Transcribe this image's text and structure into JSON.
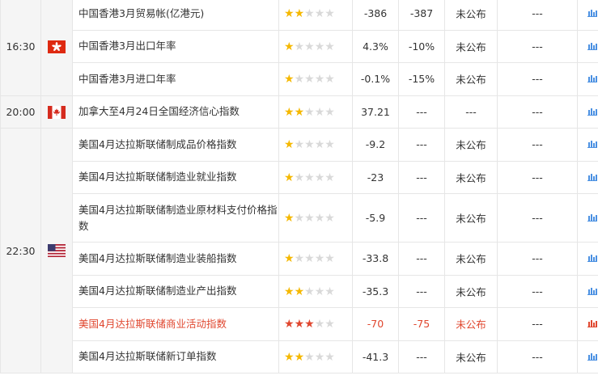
{
  "rows": [
    {
      "time": "16:30",
      "flag": "hong-kong",
      "name": "中国香港3月贸易帐(亿港元)",
      "stars": 2,
      "prev": "-386",
      "forecast": "-387",
      "actual": "未公布",
      "effect": "---",
      "highlight": false
    },
    {
      "time": "",
      "flag": "",
      "name": "中国香港3月出口年率",
      "stars": 1,
      "prev": "4.3%",
      "forecast": "-10%",
      "actual": "未公布",
      "effect": "---",
      "highlight": false
    },
    {
      "time": "",
      "flag": "",
      "name": "中国香港3月进口年率",
      "stars": 1,
      "prev": "-0.1%",
      "forecast": "-15%",
      "actual": "未公布",
      "effect": "---",
      "highlight": false
    },
    {
      "time": "20:00",
      "flag": "canada",
      "name": "加拿大至4月24日全国经济信心指数",
      "stars": 2,
      "prev": "37.21",
      "forecast": "---",
      "actual": "---",
      "effect": "---",
      "highlight": false
    },
    {
      "time": "22:30",
      "flag": "usa",
      "name": "美国4月达拉斯联储制成品价格指数",
      "stars": 1,
      "prev": "-9.2",
      "forecast": "---",
      "actual": "未公布",
      "effect": "---",
      "highlight": false
    },
    {
      "time": "",
      "flag": "",
      "name": "美国4月达拉斯联储制造业就业指数",
      "stars": 1,
      "prev": "-23",
      "forecast": "---",
      "actual": "未公布",
      "effect": "---",
      "highlight": false
    },
    {
      "time": "",
      "flag": "",
      "name": "美国4月达拉斯联储制造业原材料支付价格指数",
      "stars": 1,
      "prev": "-5.9",
      "forecast": "---",
      "actual": "未公布",
      "effect": "---",
      "highlight": false
    },
    {
      "time": "",
      "flag": "",
      "name": "美国4月达拉斯联储制造业装船指数",
      "stars": 1,
      "prev": "-33.8",
      "forecast": "---",
      "actual": "未公布",
      "effect": "---",
      "highlight": false
    },
    {
      "time": "",
      "flag": "",
      "name": "美国4月达拉斯联储制造业产出指数",
      "stars": 2,
      "prev": "-35.3",
      "forecast": "---",
      "actual": "未公布",
      "effect": "---",
      "highlight": false
    },
    {
      "time": "",
      "flag": "",
      "name": "美国4月达拉斯联储商业活动指数",
      "stars": 3,
      "prev": "-70",
      "forecast": "-75",
      "actual": "未公布",
      "effect": "---",
      "highlight": true
    },
    {
      "time": "",
      "flag": "",
      "name": "美国4月达拉斯联储新订单指数",
      "stars": 2,
      "prev": "-41.3",
      "forecast": "---",
      "actual": "未公布",
      "effect": "---",
      "highlight": false
    }
  ],
  "colors": {
    "star_on": "#f5b800",
    "star_off": "#d9d9d9",
    "highlight": "#e0472f",
    "chart_icon": "#4a90e2"
  }
}
